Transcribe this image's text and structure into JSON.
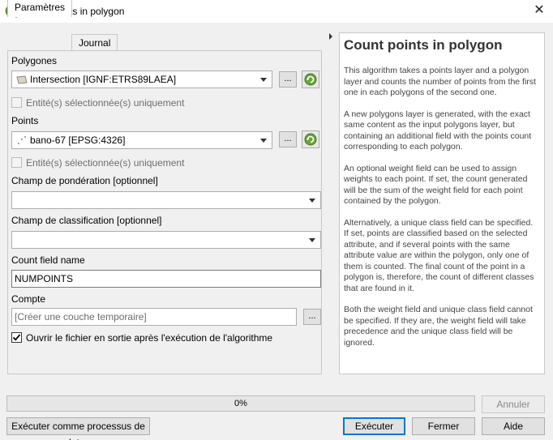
{
  "window": {
    "title": "Count points in polygon",
    "close_icon": "close-icon"
  },
  "tabs": [
    {
      "label": "Paramètres",
      "active": true
    },
    {
      "label": "Journal",
      "active": false
    }
  ],
  "params": {
    "polygons": {
      "label": "Polygones",
      "value": "Intersection [IGNF:ETRS89LAEA]",
      "selected_only": "Entité(s) sélectionnée(s) uniquement",
      "browse": "..."
    },
    "points": {
      "label": "Points",
      "value": "bano-67 [EPSG:4326]",
      "selected_only": "Entité(s) sélectionnée(s) uniquement",
      "browse": "..."
    },
    "weight": {
      "label": "Champ de pondération [optionnel]",
      "value": ""
    },
    "class": {
      "label": "Champ de classification [optionnel]",
      "value": ""
    },
    "count_field": {
      "label": "Count field name",
      "value": "NUMPOINTS"
    },
    "output": {
      "label": "Compte",
      "placeholder": "[Créer une couche temporaire]",
      "browse": "..."
    },
    "open_output": {
      "label": "Ouvrir le fichier en sortie après l'exécution de l'algorithme",
      "checked": true
    }
  },
  "help": {
    "title": "Count points in polygon",
    "paragraphs": [
      "This algorithm takes a points layer and a polygon layer and counts the number of points from the first one in each polygons of the second one.",
      "A new polygons layer is generated, with the exact same content as the input polygons layer, but containing an additional field with the points count corresponding to each polygon.",
      "An optional weight field can be used to assign weights to each point. If set, the count generated will be the sum of the weight field for each point contained by the polygon.",
      "Alternatively, a unique class field can be specified. If set, points are classified based on the selected attribute, and if several points with the same attribute value are within the polygon, only one of them is counted. The final count of the point in a polygon is, therefore, the count of different classes that are found in it.",
      "Both the weight field and unique class field cannot be specified. If they are, the weight field will take precedence and the unique class field will be ignored."
    ]
  },
  "progress": {
    "text": "0%",
    "value": 0
  },
  "buttons": {
    "cancel": "Annuler",
    "batch": "Exécuter comme processus de lot...",
    "run": "Exécuter",
    "close": "Fermer",
    "help": "Aide"
  }
}
